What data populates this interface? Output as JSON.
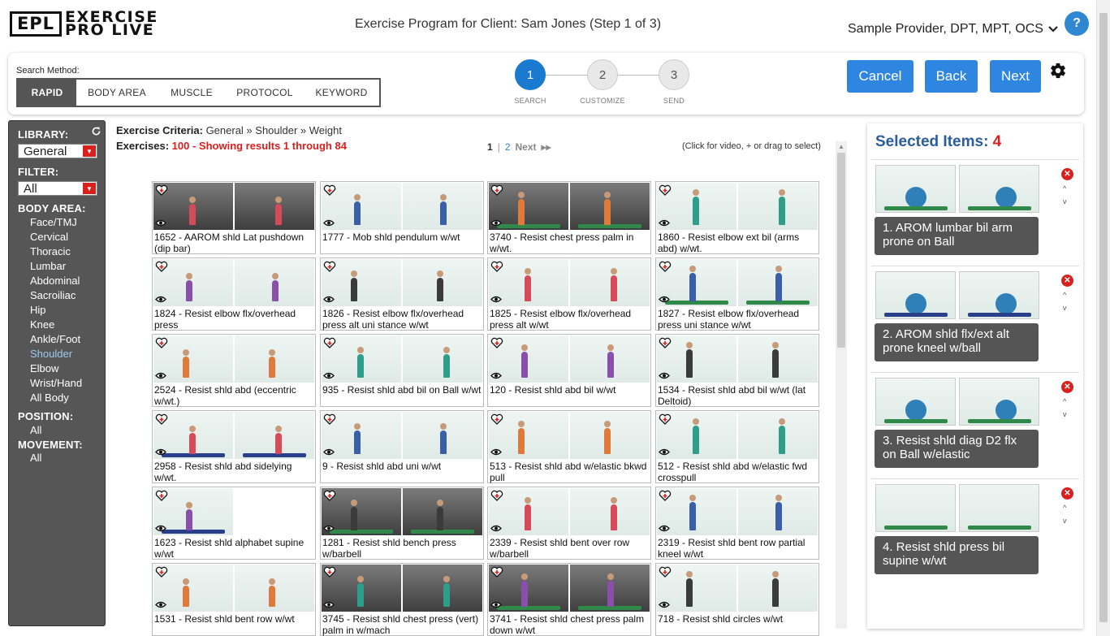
{
  "logo": {
    "box": "EPL",
    "line1": "EXERCISE",
    "line2": "PRO LIVE"
  },
  "page_title": "Exercise Program for Client: Sam Jones (Step 1 of 3)",
  "provider": "Sample Provider, DPT, MPT, OCS",
  "help": "?",
  "search": {
    "label": "Search Method:",
    "methods": [
      "RAPID",
      "BODY AREA",
      "MUSCLE",
      "PROTOCOL",
      "KEYWORD"
    ],
    "active": "RAPID"
  },
  "steps": [
    {
      "num": "1",
      "label": "SEARCH",
      "active": true
    },
    {
      "num": "2",
      "label": "CUSTOMIZE",
      "active": false
    },
    {
      "num": "3",
      "label": "SEND",
      "active": false
    }
  ],
  "buttons": {
    "cancel": "Cancel",
    "back": "Back",
    "next": "Next"
  },
  "sidebar": {
    "library_label": "LIBRARY:",
    "library_value": "General",
    "filter_label": "FILTER:",
    "filter_value": "All",
    "body_area_label": "BODY AREA:",
    "body_areas": [
      "Face/TMJ",
      "Cervical",
      "Thoracic",
      "Lumbar",
      "Abdominal",
      "Sacroiliac",
      "Hip",
      "Knee",
      "Ankle/Foot",
      "Shoulder",
      "Elbow",
      "Wrist/Hand",
      "All Body"
    ],
    "active_area": "Shoulder",
    "position_label": "POSITION:",
    "position_value": "All",
    "movement_label": "MOVEMENT:",
    "movement_value": "All"
  },
  "criteria": {
    "label": "Exercise Criteria:",
    "value": " General » Shoulder » Weight"
  },
  "exercises": {
    "label": "Exercises: ",
    "value": "100 - Showing results 1 through 84"
  },
  "pager": {
    "current": "1",
    "sep": "|",
    "page2": "2",
    "next": "Next",
    "next_icon": "▸▸"
  },
  "hint": "(Click for video, + or drag to select)",
  "cards": [
    {
      "caption": "1652 - AAROM shld Lat pushdown (dip bar)",
      "bg": "gym"
    },
    {
      "caption": "1777 - Mob shld pendulum w/wt",
      "bg": "light"
    },
    {
      "caption": "3740 - Resist chest press palm in w/wt.",
      "bg": "gym"
    },
    {
      "caption": "1860 - Resist elbow ext bil (arms abd) w/wt.",
      "bg": "light"
    },
    {
      "caption": "1824 - Resist elbow flx/overhead press",
      "bg": "light"
    },
    {
      "caption": "1826 - Resist elbow flx/overhead press alt uni stance w/wt",
      "bg": "light"
    },
    {
      "caption": "1825 - Resist elbow flx/overhead press alt w/wt",
      "bg": "light"
    },
    {
      "caption": "1827 - Resist elbow flx/overhead press uni stance w/wt",
      "bg": "light"
    },
    {
      "caption": "2524 - Resist shld abd (eccentric w/wt.)",
      "bg": "light"
    },
    {
      "caption": "935 - Resist shld abd bil on Ball w/wt",
      "bg": "light"
    },
    {
      "caption": "120 - Resist shld abd bil w/wt",
      "bg": "light"
    },
    {
      "caption": "1534 - Resist shld abd bil w/wt (lat Deltoid)",
      "bg": "light"
    },
    {
      "caption": "2958 - Resist shld abd sidelying w/wt.",
      "bg": "light"
    },
    {
      "caption": "9 - Resist shld abd uni w/wt",
      "bg": "light"
    },
    {
      "caption": "513 - Resist shld abd w/elastic bkwd pull",
      "bg": "light"
    },
    {
      "caption": "512 - Resist shld abd w/elastic fwd crosspull",
      "bg": "light"
    },
    {
      "caption": "1623 - Resist shld alphabet supine w/wt",
      "bg": "single"
    },
    {
      "caption": "1281 - Resist shld bench press w/barbell",
      "bg": "gym"
    },
    {
      "caption": "2339 - Resist shld bent over row w/barbell",
      "bg": "light"
    },
    {
      "caption": "2319 - Resist shld bent row partial kneel w/wt",
      "bg": "light"
    },
    {
      "caption": "1531 - Resist shld bent row w/wt",
      "bg": "light"
    },
    {
      "caption": "3745 - Resist shld chest press (vert) palm in w/mach",
      "bg": "gym"
    },
    {
      "caption": "3741 - Resist shld chest press palm down w/wt",
      "bg": "gym"
    },
    {
      "caption": "718 - Resist shld circles w/wt",
      "bg": "light"
    }
  ],
  "selected": {
    "title": "Selected Items: ",
    "count": "4",
    "items": [
      "1. AROM lumbar bil arm prone on Ball",
      "2. AROM shld flx/ext alt prone kneel w/ball",
      "3. Resist shld diag D2 flx on Ball w/elastic",
      "4. Resist shld press bil supine w/wt"
    ]
  },
  "colors": {
    "accent": "#2f86e0",
    "danger": "#d9201c",
    "sidebar": "#565656",
    "title_blue": "#2a5d9e"
  }
}
